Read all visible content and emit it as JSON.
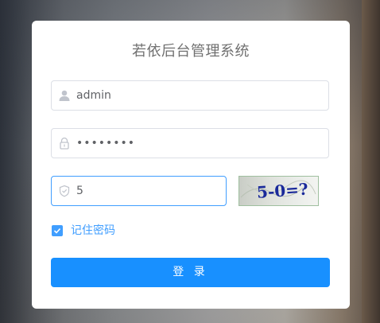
{
  "title": "若依后台管理系统",
  "username": {
    "value": "admin",
    "icon": "user-icon"
  },
  "password": {
    "masked_value": "••••••••",
    "icon": "lock-icon"
  },
  "captcha": {
    "input_value": "5",
    "icon": "shield-icon",
    "image_text": "5-0=?"
  },
  "remember": {
    "label": "记住密码",
    "checked": true
  },
  "login_button": {
    "label": "登 录"
  },
  "colors": {
    "primary": "#1890ff",
    "accent": "#409eff",
    "card": "#ffffff"
  }
}
